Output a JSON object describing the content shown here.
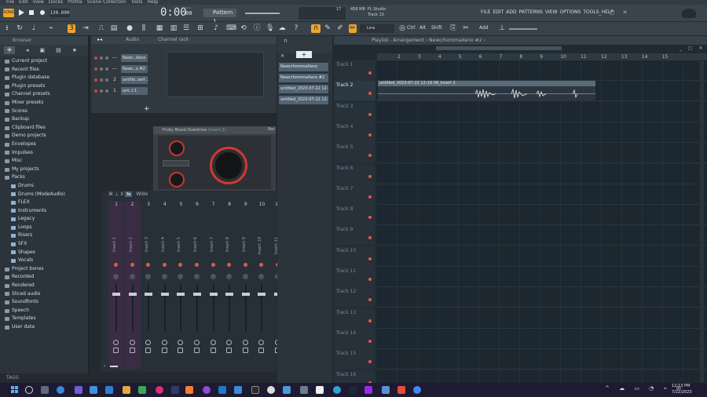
{
  "menu": [
    "File",
    "Edit",
    "View",
    "Docks",
    "Profile",
    "Scene Collection",
    "Tools",
    "Help"
  ],
  "transport": {
    "tempo": "130.000",
    "time": "0:00",
    "time_sub": "00",
    "time_unit": "M:S:CS",
    "pattern": "Pattern 1",
    "cpu": "17",
    "memory": "458 MB",
    "app_name": "FL Studio",
    "hint": "Track 15"
  },
  "main_menu": [
    "FILE",
    "EDIT",
    "ADD",
    "PATTERNS",
    "VIEW",
    "OPTIONS",
    "TOOLS",
    "HELP"
  ],
  "toolbar": {
    "line_mode": "Line",
    "ctrl": "Ctrl",
    "alt": "Alt",
    "shift": "Shift",
    "add": "Add"
  },
  "browser": {
    "title": "Browser",
    "items": [
      {
        "label": "Current project",
        "indent": 0,
        "type": "folder"
      },
      {
        "label": "Recent files",
        "indent": 0,
        "type": "folder"
      },
      {
        "label": "Plugin database",
        "indent": 0,
        "type": "folder"
      },
      {
        "label": "Plugin presets",
        "indent": 0,
        "type": "folder"
      },
      {
        "label": "Channel presets",
        "indent": 0,
        "type": "folder"
      },
      {
        "label": "Mixer presets",
        "indent": 0,
        "type": "folder"
      },
      {
        "label": "Scores",
        "indent": 0,
        "type": "folder"
      },
      {
        "label": "Backup",
        "indent": 0,
        "type": "folder"
      },
      {
        "label": "Clipboard files",
        "indent": 0,
        "type": "folder"
      },
      {
        "label": "Demo projects",
        "indent": 0,
        "type": "folder"
      },
      {
        "label": "Envelopes",
        "indent": 0,
        "type": "folder"
      },
      {
        "label": "Impulses",
        "indent": 0,
        "type": "folder"
      },
      {
        "label": "Misc",
        "indent": 0,
        "type": "folder"
      },
      {
        "label": "My projects",
        "indent": 0,
        "type": "folder"
      },
      {
        "label": "Packs",
        "indent": 0,
        "type": "open"
      },
      {
        "label": "Drums",
        "indent": 1,
        "type": "pack"
      },
      {
        "label": "Drums (ModeAudio)",
        "indent": 1,
        "type": "pack"
      },
      {
        "label": "FLEX",
        "indent": 1,
        "type": "pack"
      },
      {
        "label": "Instruments",
        "indent": 1,
        "type": "pack"
      },
      {
        "label": "Legacy",
        "indent": 1,
        "type": "pack"
      },
      {
        "label": "Loops",
        "indent": 1,
        "type": "pack"
      },
      {
        "label": "Risers",
        "indent": 1,
        "type": "pack"
      },
      {
        "label": "SFX",
        "indent": 1,
        "type": "pack"
      },
      {
        "label": "Shapes",
        "indent": 1,
        "type": "pack"
      },
      {
        "label": "Vocals",
        "indent": 1,
        "type": "pack"
      },
      {
        "label": "Project bones",
        "indent": 0,
        "type": "folder"
      },
      {
        "label": "Recorded",
        "indent": 0,
        "type": "folder"
      },
      {
        "label": "Rendered",
        "indent": 0,
        "type": "folder"
      },
      {
        "label": "Sliced audio",
        "indent": 0,
        "type": "folder"
      },
      {
        "label": "Soundfonts",
        "indent": 0,
        "type": "folder"
      },
      {
        "label": "Speech",
        "indent": 0,
        "type": "folder"
      },
      {
        "label": "Templates",
        "indent": 0,
        "type": "folder"
      },
      {
        "label": "User data",
        "indent": 0,
        "type": "folder"
      }
    ],
    "tags": "TAGS"
  },
  "channel_rack": {
    "filter": "Audio",
    "title": "Channel rack",
    "channels": [
      {
        "num": "---",
        "name": "Newc..Xeno"
      },
      {
        "num": "---",
        "name": "Newc..o #2"
      },
      {
        "num": "2",
        "name": "untitle..sert 2"
      },
      {
        "num": "1",
        "name": "unt..t 1"
      }
    ],
    "add": "+"
  },
  "plugin": {
    "title": "Fruity Blood Overdrive",
    "subtitle": "(Insert 2)",
    "mode_btn": "Roc"
  },
  "mixer": {
    "view_label": "Wide",
    "strips": [
      {
        "num": "1",
        "name": "Insert 1"
      },
      {
        "num": "2",
        "name": "Insert 2"
      },
      {
        "num": "3",
        "name": "Insert 3"
      },
      {
        "num": "4",
        "name": "Insert 4"
      },
      {
        "num": "5",
        "name": "Insert 5"
      },
      {
        "num": "6",
        "name": "Insert 6"
      },
      {
        "num": "7",
        "name": "Insert 7"
      },
      {
        "num": "8",
        "name": "Insert 8"
      },
      {
        "num": "9",
        "name": "Insert 9"
      },
      {
        "num": "10",
        "name": "Insert 10"
      },
      {
        "num": "11",
        "name": "Insert 11"
      }
    ]
  },
  "patterns": {
    "items": [
      "NewcrhommaXeno",
      "NewcrhommaXeno #2",
      "untitled_2023-07-22 12-...",
      "untitled_2023-07-22 12-..."
    ]
  },
  "playlist": {
    "title": "Playlist - Arrangement",
    "breadcrumb": "NewcrhommaXeno #2",
    "ruler": [
      "2",
      "3",
      "4",
      "5",
      "6",
      "7",
      "8",
      "9",
      "10",
      "11",
      "12",
      "13",
      "14",
      "15"
    ],
    "tracks": [
      "Track 1",
      "Track 2",
      "Track 3",
      "Track 4",
      "Track 5",
      "Track 6",
      "Track 7",
      "Track 8",
      "Track 9",
      "Track 10",
      "Track 11",
      "Track 12",
      "Track 13",
      "Track 14",
      "Track 15",
      "Track 16"
    ],
    "clip_label": "untitled_2023-07-22 12-19-36_Insert 2"
  },
  "taskbar": {
    "time": "12:13 PM",
    "date": "7/22/2023"
  }
}
